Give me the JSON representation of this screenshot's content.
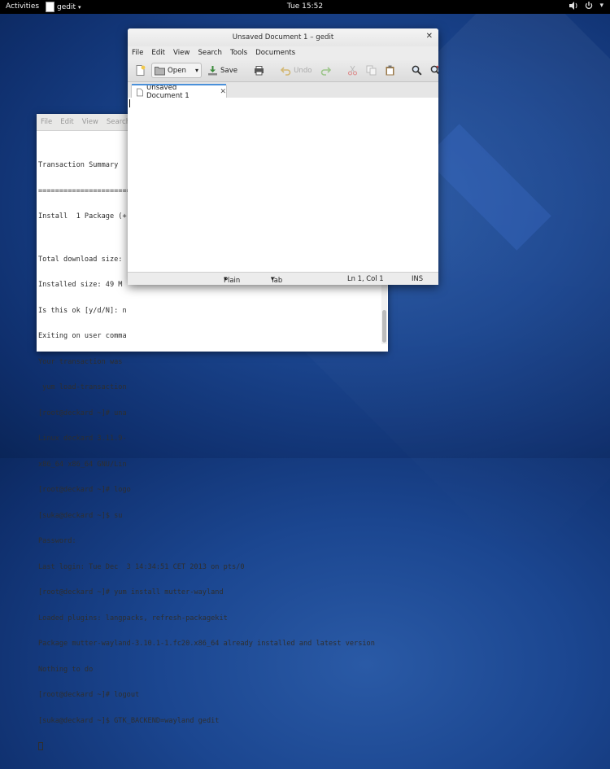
{
  "topbar": {
    "activities": "Activities",
    "app_name": "gedit",
    "clock": "Tue 15:52",
    "tray_icons": [
      "volume-icon",
      "power-icon",
      "chevron-down-icon"
    ]
  },
  "terminal": {
    "menu": [
      "File",
      "Edit",
      "View",
      "Search"
    ],
    "lines": [
      "Transaction Summary",
      "================================================================================",
      "Install  1 Package (+",
      "",
      "Total download size:",
      "Installed size: 49 M",
      "Is this ok [y/d/N]: n",
      "Exiting on user comma",
      "Your transaction was",
      " yum load-transaction",
      "[root@deckard ~]# una",
      "Linux deckard 3.11.9-",
      "x86_64 x86_64 GNU/Lin",
      "[root@deckard ~]# logo",
      "[suka@deckard ~]$ su",
      "Password:",
      "Last login: Tue Dec  3 14:34:51 CET 2013 on pts/0",
      "[root@deckard ~]# yum install mutter-wayland",
      "Loaded plugins: langpacks, refresh-packagekit",
      "Package mutter-wayland-3.10.1-1.fc20.x86_64 already installed and latest version",
      "Nothing to do",
      "[root@deckard ~]# logout",
      "[suka@deckard ~]$ GTK_BACKEND=wayland gedit"
    ]
  },
  "gedit": {
    "title": "Unsaved Document 1 – gedit",
    "menu": [
      "File",
      "Edit",
      "View",
      "Search",
      "Tools",
      "Documents"
    ],
    "toolbar": {
      "open": "Open",
      "save": "Save",
      "undo": "Undo"
    },
    "tab_label": "Unsaved Document 1",
    "status": {
      "language": "Plain Text",
      "tab_width": "Tab Width: 8",
      "position": "Ln 1, Col 1",
      "mode": "INS"
    }
  }
}
